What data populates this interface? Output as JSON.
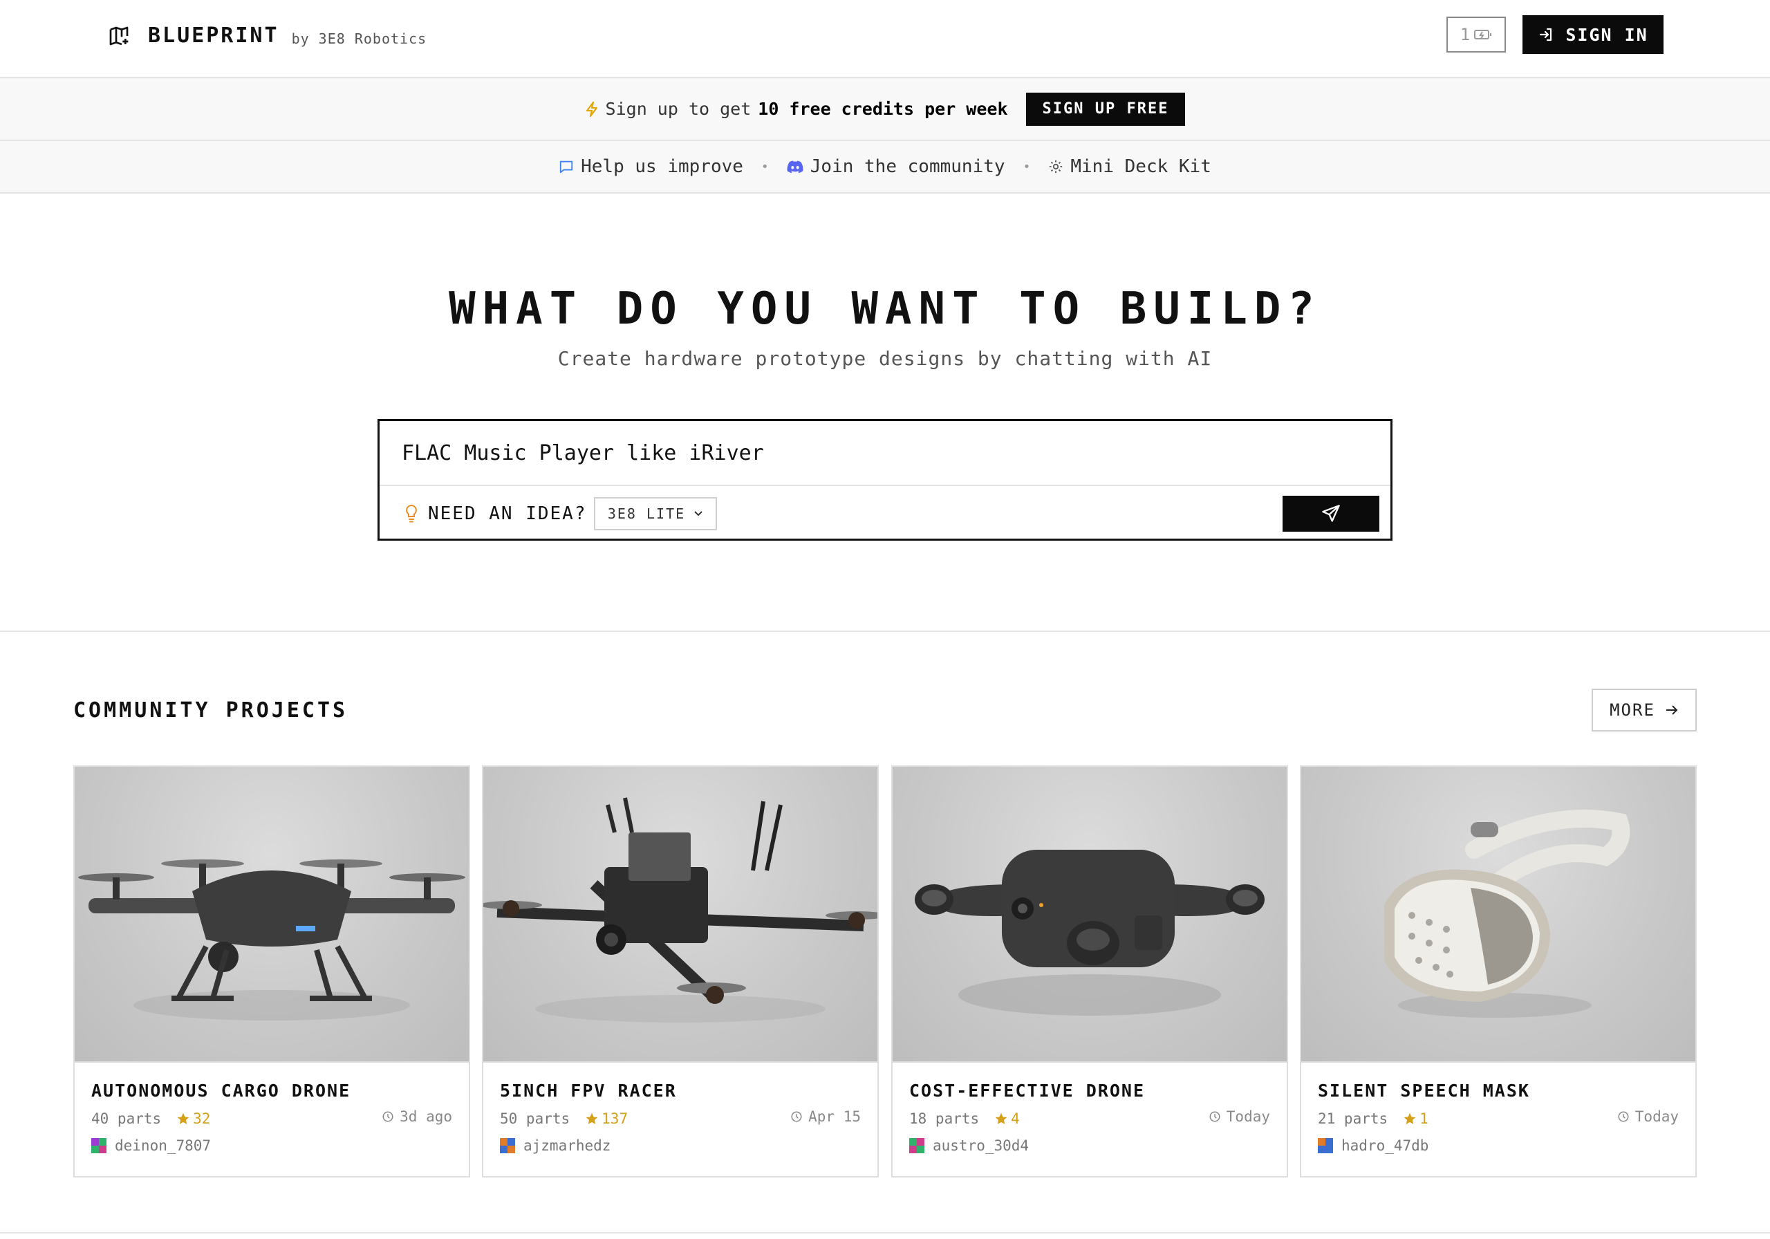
{
  "header": {
    "brand_name": "BLUEPRINT",
    "brand_by": "by 3E8 Robotics",
    "credits_count": "1",
    "sign_in_label": "SIGN IN"
  },
  "promo": {
    "prefix": "Sign up to get",
    "highlight": "10 free credits per week",
    "button_label": "SIGN UP FREE"
  },
  "links": {
    "items": [
      {
        "label": "Help us improve",
        "icon": "message-icon"
      },
      {
        "label": "Join the community",
        "icon": "discord-icon"
      },
      {
        "label": "Mini Deck Kit",
        "icon": "gear-icon"
      }
    ]
  },
  "hero": {
    "title": "WHAT DO YOU WANT TO BUILD?",
    "subtitle": "Create hardware prototype designs by chatting with AI"
  },
  "prompt": {
    "value": "FLAC Music Player like iRiver",
    "idea_label": "NEED AN IDEA?",
    "model_selected": "3E8 LITE"
  },
  "community": {
    "title": "COMMUNITY PROJECTS",
    "more_label": "MORE",
    "projects": [
      {
        "title": "AUTONOMOUS CARGO DRONE",
        "parts": "40 parts",
        "stars": "32",
        "date": "3d ago",
        "author": "deinon_7807"
      },
      {
        "title": "5INCH FPV RACER",
        "parts": "50 parts",
        "stars": "137",
        "date": "Apr 15",
        "author": "ajzmarhedz"
      },
      {
        "title": "COST-EFFECTIVE DRONE",
        "parts": "18 parts",
        "stars": "4",
        "date": "Today",
        "author": "austro_30d4"
      },
      {
        "title": "SILENT SPEECH MASK",
        "parts": "21 parts",
        "stars": "1",
        "date": "Today",
        "author": "hadro_47db"
      }
    ]
  },
  "colors": {
    "accent_black": "#0b0b0b",
    "star_gold": "#d4a017",
    "bolt_yellow": "#e0a800",
    "discord_purple": "#5865f2",
    "link_blue": "#3b82f6"
  }
}
